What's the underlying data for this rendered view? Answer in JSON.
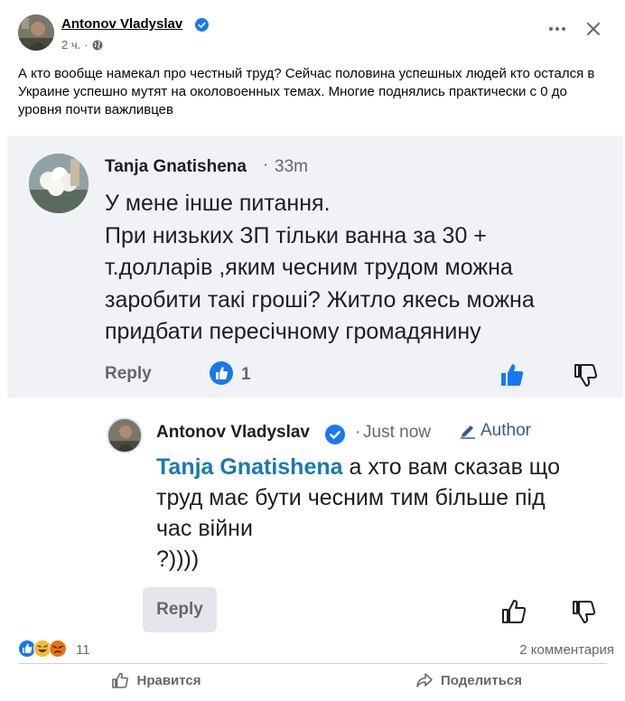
{
  "post": {
    "author": "Antonov Vladyslav",
    "time": "2 ч.",
    "text": "А кто  вообще намекал про честный труд? Сейчас половина успешных людей кто остался в Украине успешно мутят на околовоенных темах. Многие поднялись практически с 0 до уровня почти важливцев"
  },
  "comment": {
    "author": "Tanja Gnatishena",
    "time": "33m",
    "lines": [
      "У мене інше питання.",
      "При низьких ЗП тільки ванна за 30 +",
      "т.долларів ,яким чесним трудом можна",
      "заробити такі гроші? Житло якесь можна",
      "придбати пересічному громадянину"
    ],
    "reply_label": "Reply",
    "like_count": "1"
  },
  "reply": {
    "author": "Antonov Vladyslav",
    "time": "Just now",
    "author_badge": "Author",
    "mention": "Tanja Gnatishena",
    "line1_rest": " а хто вам сказав що",
    "line2": "труд має бути чесним тим більше під",
    "line3": "час війни",
    "line4": "?))))",
    "reply_label": "Reply"
  },
  "footer": {
    "reaction_icons": [
      "like-icon",
      "haha-icon",
      "angry-icon"
    ],
    "reaction_count": "11",
    "comment_count": "2 комментария",
    "like_label": "Нравится",
    "share_label": "Поделиться"
  },
  "colors": {
    "facebook_blue": "#1877f2",
    "mention_blue": "#1879b5",
    "author_link": "#385898",
    "muted_text": "#65676b",
    "comment_bg": "#f0f2f5"
  }
}
